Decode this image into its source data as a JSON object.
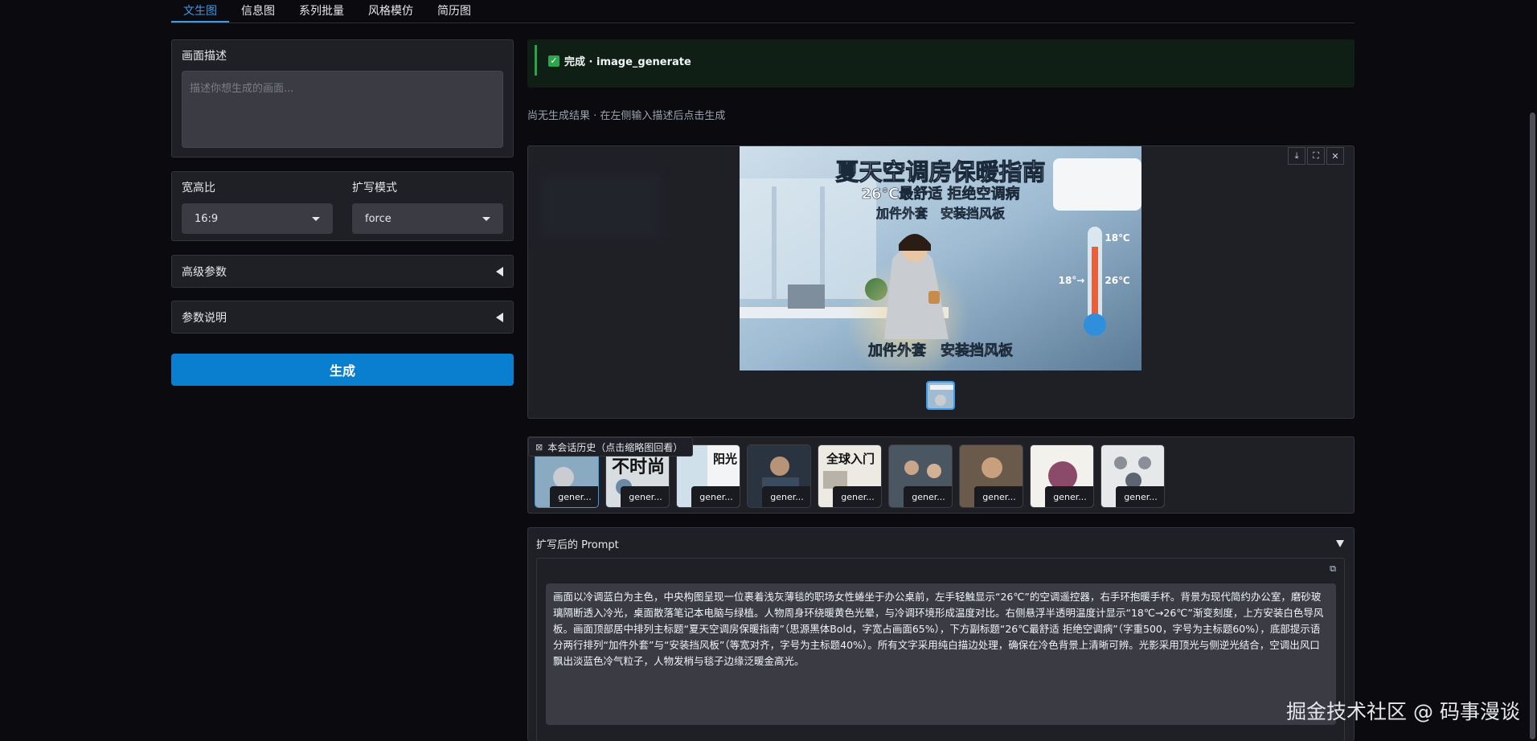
{
  "tabs": [
    {
      "label": "文生图",
      "active": true
    },
    {
      "label": "信息图"
    },
    {
      "label": "系列批量"
    },
    {
      "label": "风格模仿"
    },
    {
      "label": "简历图"
    }
  ],
  "description": {
    "label": "画面描述",
    "placeholder": "描述你想生成的画面..."
  },
  "options": {
    "aspect_label": "宽高比",
    "aspect_value": "16:9",
    "expand_label": "扩写模式",
    "expand_value": "force"
  },
  "accordions": {
    "advanced": "高级参数",
    "help": "参数说明"
  },
  "generate_button": "生成",
  "status": {
    "text": "完成 · image_generate",
    "check": "✓"
  },
  "no_result": "尚无生成结果 · 在左侧输入描述后点击生成",
  "image": {
    "title": "夏天空调房保暖指南",
    "subtitle": "26℃最舒适 拒绝空调病",
    "tips": "加件外套　安装挡风板",
    "bottom": "加件外套　安装挡风板",
    "temp_high": "18℃",
    "temp_low": "26℃",
    "temp_arrow": "18°→"
  },
  "history": {
    "label": "本会话历史（点击缩略图回看）",
    "thumb_texts": [
      "",
      "不时尚",
      "阳光",
      "",
      "全球入门",
      "",
      "",
      "",
      ""
    ],
    "items": [
      "gener...",
      "gener...",
      "gener...",
      "gener...",
      "gener...",
      "gener...",
      "gener...",
      "gener...",
      "gener..."
    ]
  },
  "prompt": {
    "header": "扩写后的 Prompt",
    "text": "画面以冷调蓝白为主色，中央构图呈现一位裹着浅灰薄毯的职场女性蜷坐于办公桌前，左手轻触显示“26℃”的空调遥控器，右手环抱暖手杯。背景为现代简约办公室，磨砂玻璃隔断透入冷光，桌面散落笔记本电脑与绿植。人物周身环绕暖黄色光晕，与冷调环境形成温度对比。右侧悬浮半透明温度计显示“18℃→26℃”渐变刻度，上方安装白色导风板。画面顶部居中排列主标题“夏天空调房保暖指南”（思源黑体Bold，字宽占画面65%），下方副标题“26℃最舒适 拒绝空调病”（字重500，字号为主标题60%），底部提示语分两行排列“加件外套”与“安装挡风板”（等宽对齐，字号为主标题40%）。所有文字采用纯白描边处理，确保在冷色背景上清晰可辨。光影采用顶光与侧逆光结合，空调出风口飘出淡蓝色冷气粒子，人物发梢与毯子边缘泛暖金高光。"
  },
  "watermark": "掘金技术社区 @ 码事漫谈",
  "colors": {
    "accent": "#3b9be8",
    "button": "#0a7fd0",
    "success": "#2ea44f"
  }
}
